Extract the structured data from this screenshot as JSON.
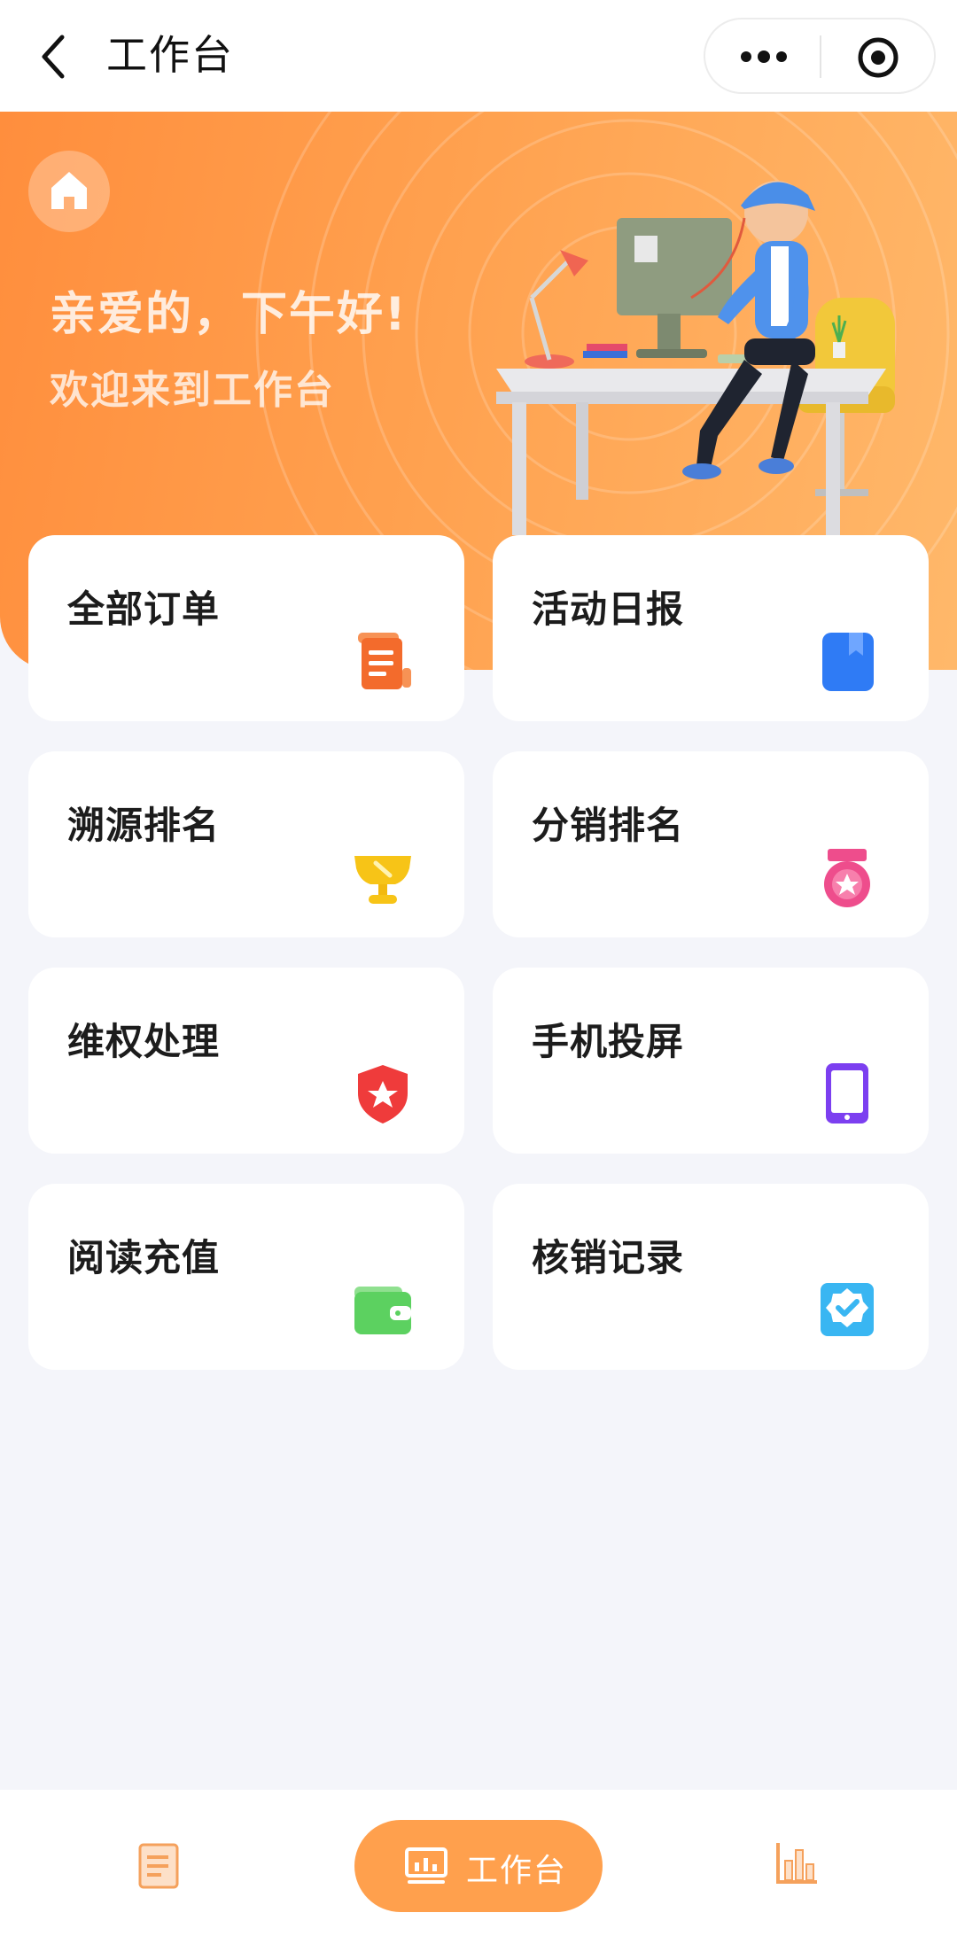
{
  "nav": {
    "title": "工作台",
    "back_icon": "chevron-left-icon",
    "more_icon": "more-dots-icon",
    "close_icon": "target-circle-icon"
  },
  "banner": {
    "greeting": "亲爱的，下午好!",
    "subtitle": "欢迎来到工作台",
    "home_icon": "home-icon",
    "accent": "#ff9a46"
  },
  "cards": [
    {
      "label": "全部订单",
      "icon": "scroll-icon",
      "color": "#f36b2c"
    },
    {
      "label": "活动日报",
      "icon": "bookmark-book-icon",
      "color": "#2f7bf5"
    },
    {
      "label": "溯源排名",
      "icon": "trophy-icon",
      "color": "#f7c417"
    },
    {
      "label": "分销排名",
      "icon": "medal-icon",
      "color": "#ee4d8c"
    },
    {
      "label": "维权处理",
      "icon": "shield-star-icon",
      "color": "#ef3b3b"
    },
    {
      "label": "手机投屏",
      "icon": "phone-icon",
      "color": "#7c3ff0"
    },
    {
      "label": "阅读充值",
      "icon": "wallet-icon",
      "color": "#5cd160"
    },
    {
      "label": "核销记录",
      "icon": "verified-badge-icon",
      "color": "#39b6f2"
    }
  ],
  "tabbar": {
    "items": [
      {
        "label": "",
        "icon": "document-icon"
      },
      {
        "label": "工作台",
        "icon": "monitor-chart-icon",
        "active": true
      },
      {
        "label": "",
        "icon": "bar-chart-icon"
      }
    ],
    "active_color": "#ffa04d",
    "inactive_color": "#f5a15c"
  }
}
